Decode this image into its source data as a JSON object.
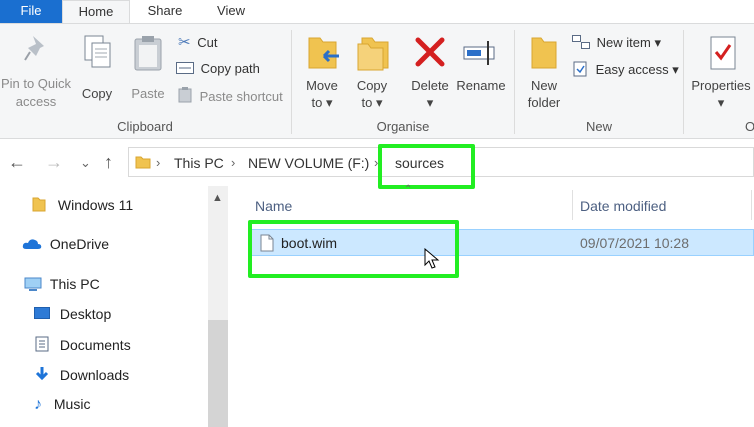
{
  "tabs": {
    "file": "File",
    "home": "Home",
    "share": "Share",
    "view": "View"
  },
  "ribbon": {
    "pin_line1": "Pin to Quick",
    "pin_line2": "access",
    "copy": "Copy",
    "paste": "Paste",
    "cut": "Cut",
    "copy_path": "Copy path",
    "paste_shortcut": "Paste shortcut",
    "clipboard_group": "Clipboard",
    "move_to_line1": "Move",
    "move_to_line2": "to",
    "copy_to_line1": "Copy",
    "copy_to_line2": "to",
    "delete": "Delete",
    "rename": "Rename",
    "organise_group": "Organise",
    "new_folder_line1": "New",
    "new_folder_line2": "folder",
    "new_item": "New item",
    "easy_access": "Easy access",
    "new_group": "New",
    "properties": "Properties",
    "open_group_partial": "O"
  },
  "address": {
    "crumb1": "This PC",
    "crumb2": "NEW VOLUME (F:)",
    "crumb3": "sources"
  },
  "nav": {
    "items": [
      "Windows 11",
      "OneDrive",
      "This PC",
      "Desktop",
      "Documents",
      "Downloads",
      "Music"
    ]
  },
  "list": {
    "col_name": "Name",
    "col_date": "Date modified",
    "files": [
      {
        "name": "boot.wim",
        "date": "09/07/2021 10:28"
      }
    ]
  },
  "colors": {
    "highlight": "#22ee22",
    "accent": "#1a6fd0",
    "selection": "#cce8ff"
  }
}
